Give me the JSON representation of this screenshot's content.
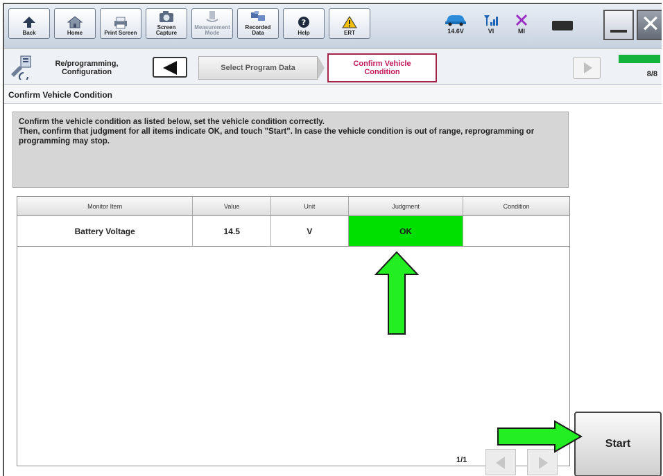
{
  "toolbar": {
    "buttons": [
      {
        "label": "Back",
        "icon": "back-arrow-icon"
      },
      {
        "label": "Home",
        "icon": "home-icon"
      },
      {
        "label": "Print Screen",
        "icon": "printer-icon"
      },
      {
        "label": "Screen\nCapture",
        "icon": "camera-icon"
      },
      {
        "label": "Measurement\nMode",
        "icon": "measurement-icon"
      },
      {
        "label": "Recorded\nData",
        "icon": "recorded-data-icon"
      },
      {
        "label": "Help",
        "icon": "help-icon"
      },
      {
        "label": "ERT",
        "icon": "warning-icon"
      }
    ],
    "status": {
      "voltage": "14.6V",
      "vi": "VI",
      "mi": "MI"
    }
  },
  "stepbar": {
    "title": "Re/programming,\nConfiguration",
    "previous_step": "Select Program Data",
    "current_step": "Confirm Vehicle\nCondition",
    "progress": "8/8",
    "progress_fraction": 1.0
  },
  "section_title": "Confirm Vehicle Condition",
  "instructions": "Confirm the vehicle condition as listed below, set the vehicle condition correctly.\nThen, confirm that judgment for all items indicate OK, and touch \"Start\". In case the vehicle condition is out of range, reprogramming or programming may stop.",
  "table": {
    "columns": [
      "Monitor Item",
      "Value",
      "Unit",
      "Judgment",
      "Condition"
    ],
    "rows": [
      {
        "item": "Battery Voltage",
        "value": "14.5",
        "unit": "V",
        "judgment": "OK",
        "condition": ""
      }
    ]
  },
  "pager": "1/1",
  "start_label": "Start",
  "colors": {
    "ok_green": "#00e000",
    "annotation_arrow": "#22ee22",
    "current_step_border": "#a3264a"
  }
}
